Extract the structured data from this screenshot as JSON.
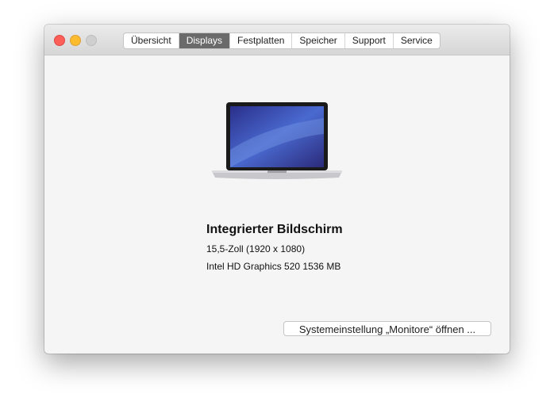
{
  "tabs": [
    "Übersicht",
    "Displays",
    "Festplatten",
    "Speicher",
    "Support",
    "Service"
  ],
  "active_tab": "Displays",
  "display": {
    "name": "Integrierter Bildschirm",
    "size": "15,5-Zoll (1920 x 1080)",
    "graphics": "Intel HD Graphics 520 1536 MB"
  },
  "button_label": "Systemeinstellung „Monitore“ öffnen ..."
}
